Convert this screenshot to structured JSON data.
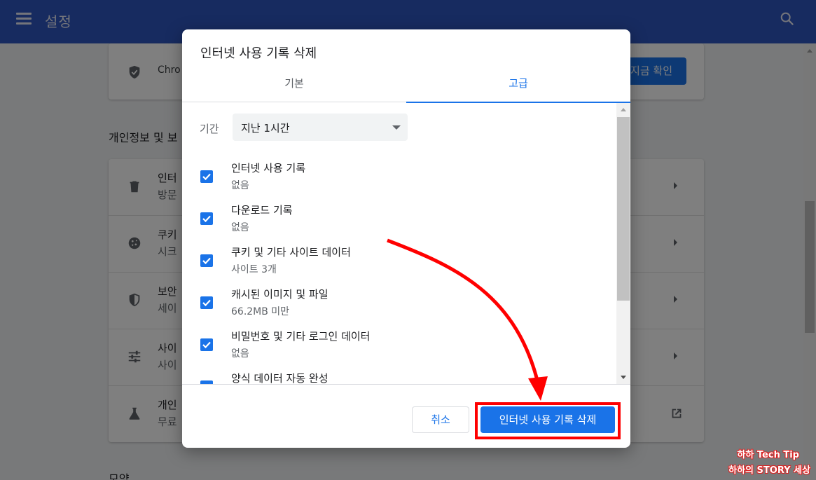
{
  "topbar": {
    "title": "설정",
    "bg": "#2f57c0"
  },
  "card1": {
    "text": "Chro",
    "button": "지금 확인"
  },
  "section1": {
    "title": "개인정보 및 보"
  },
  "section2": {
    "title": "모양"
  },
  "rows": [
    {
      "l1": "인터",
      "l2": "방문",
      "icon": "trash-icon"
    },
    {
      "l1": "쿠키",
      "l2": "시크",
      "icon": "cookie-icon"
    },
    {
      "l1": "보안",
      "l2": "세이",
      "icon": "security-shield-icon"
    },
    {
      "l1": "사이",
      "l2": "사이",
      "icon": "tune-icon"
    },
    {
      "l1": "개인",
      "l2": "무료",
      "icon": "flask-icon"
    }
  ],
  "dialog": {
    "title": "인터넷 사용 기록 삭제",
    "tabs": {
      "basic": "기본",
      "advanced": "고급"
    },
    "period": {
      "label": "기간",
      "value": "지난 1시간"
    },
    "items": [
      {
        "title": "인터넷 사용 기록",
        "sub": "없음",
        "checked": true
      },
      {
        "title": "다운로드 기록",
        "sub": "없음",
        "checked": true
      },
      {
        "title": "쿠키 및 기타 사이트 데이터",
        "sub": "사이트 3개",
        "checked": true
      },
      {
        "title": "캐시된 이미지 및 파일",
        "sub": "66.2MB 미만",
        "checked": true
      },
      {
        "title": "비밀번호 및 기타 로그인 데이터",
        "sub": "없음",
        "checked": true
      },
      {
        "title": "양식 데이터 자동 완성",
        "sub": "",
        "checked": true
      }
    ],
    "cancel": "취소",
    "clear": "인터넷 사용 기록 삭제",
    "accent": "#1a73e8"
  },
  "watermark": {
    "line1": "하하 Tech Tip",
    "line2": "하하의 STORY 세상"
  },
  "annotation_color": "#ff0000"
}
